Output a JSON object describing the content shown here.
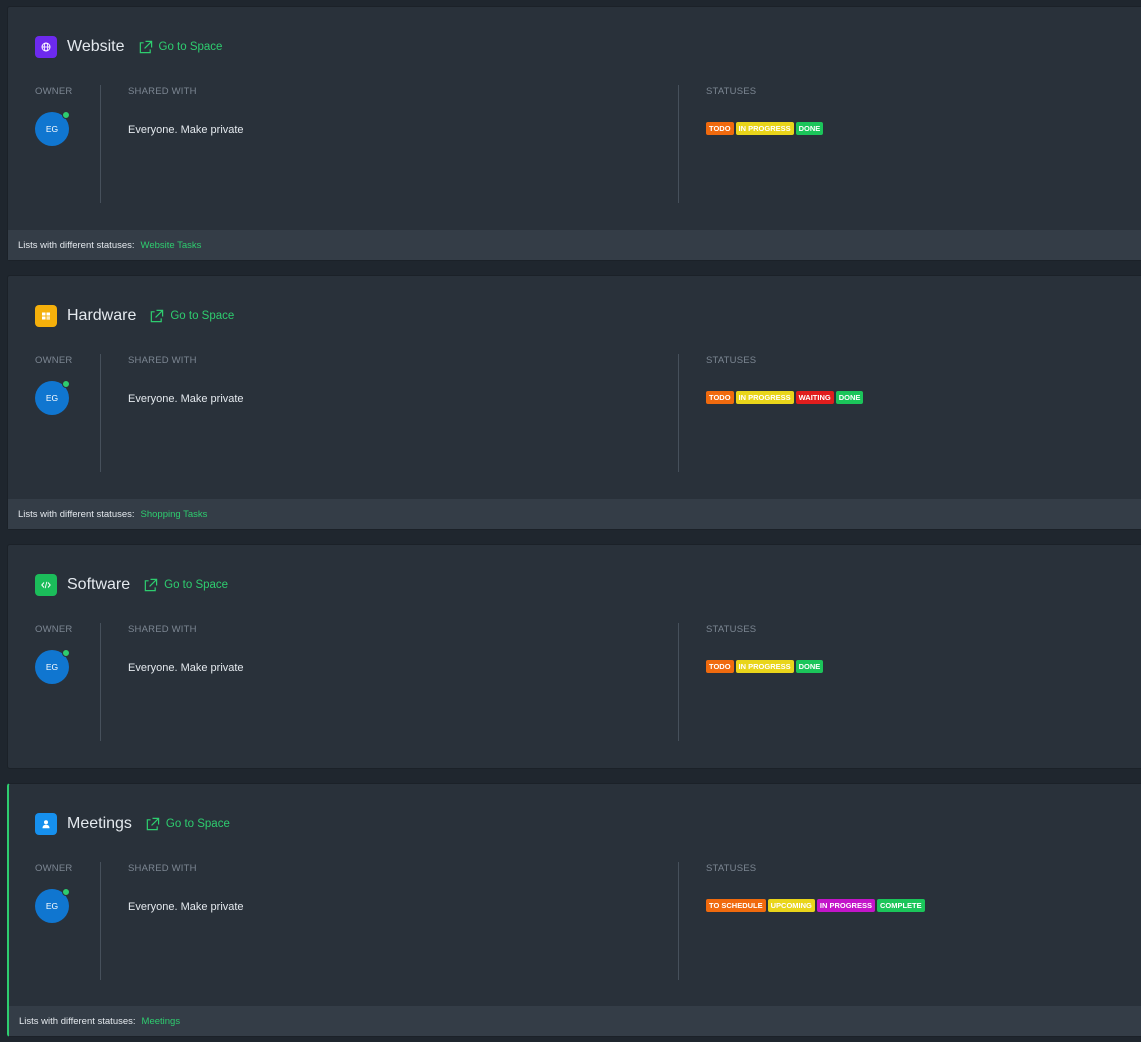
{
  "labels": {
    "owner": "OWNER",
    "shared_with": "SHARED WITH",
    "statuses": "STATUSES",
    "goto": "Go to Space",
    "footer_prefix": "Lists with different statuses:"
  },
  "colors": {
    "accent": "#2ecd6f",
    "avatar": "#1076d0"
  },
  "spaces": [
    {
      "name": "Website",
      "icon": "globe-icon",
      "icon_color": "#6d2aee",
      "owner_initials": "EG",
      "shared_text": "Everyone. Make private",
      "statuses": [
        {
          "label": "TODO",
          "color": "#f06a0e"
        },
        {
          "label": "IN PROGRESS",
          "color": "#e9d51a"
        },
        {
          "label": "DONE",
          "color": "#1bc55a"
        }
      ],
      "footer_link": "Website Tasks"
    },
    {
      "name": "Hardware",
      "icon": "grid-icon",
      "icon_color": "#f5b00b",
      "owner_initials": "EG",
      "shared_text": "Everyone. Make private",
      "statuses": [
        {
          "label": "TODO",
          "color": "#f06a0e"
        },
        {
          "label": "IN PROGRESS",
          "color": "#e9d51a"
        },
        {
          "label": "WAITING",
          "color": "#e11d1d"
        },
        {
          "label": "DONE",
          "color": "#1bc55a"
        }
      ],
      "footer_link": "Shopping Tasks"
    },
    {
      "name": "Software",
      "icon": "code-icon",
      "icon_color": "#1bbd5a",
      "owner_initials": "EG",
      "shared_text": "Everyone. Make private",
      "statuses": [
        {
          "label": "TODO",
          "color": "#f06a0e"
        },
        {
          "label": "IN PROGRESS",
          "color": "#e9d51a"
        },
        {
          "label": "DONE",
          "color": "#1bc55a"
        }
      ],
      "footer_link": null
    },
    {
      "name": "Meetings",
      "icon": "person-icon",
      "icon_color": "#1690ee",
      "owner_initials": "EG",
      "shared_text": "Everyone. Make private",
      "statuses": [
        {
          "label": "TO SCHEDULE",
          "color": "#f06a0e"
        },
        {
          "label": "UPCOMING",
          "color": "#e9d51a"
        },
        {
          "label": "IN PROGRESS",
          "color": "#c315c9"
        },
        {
          "label": "COMPLETE",
          "color": "#1bc55a"
        }
      ],
      "footer_link": "Meetings"
    }
  ]
}
